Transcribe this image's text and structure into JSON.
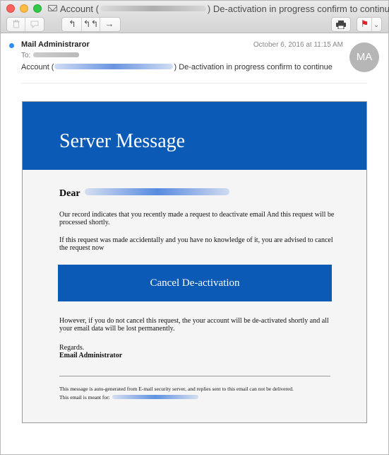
{
  "window": {
    "title_prefix": "Account (",
    "title_suffix": ") De-activation in progress confirm to continue"
  },
  "toolbar": {
    "trash_icon": "trash-icon",
    "junk_icon": "junk-icon",
    "reply_glyph": "↰",
    "reply_all_glyph": "↰↰",
    "forward_glyph": "→",
    "print_glyph": "⎙",
    "flag_glyph": "⚑",
    "flag_menu_glyph": "⌄"
  },
  "header": {
    "from": "Mail Administraror",
    "to_label": "To:",
    "subject_prefix": "Account (",
    "subject_suffix": ") De-activation in progress confirm to continue",
    "date": "October 6, 2016 at 11:15 AM",
    "avatar_initials": "MA"
  },
  "body": {
    "banner_title": "Server Message",
    "greeting": "Dear",
    "para1": "Our record indicates that you recently made a request to deactivate email And this request will be processed shortly.",
    "para2": "If this request was made accidentally and you have no knowledge of it, you are advised to cancel the request now",
    "cta_label": "Cancel De-activation",
    "para3": "However, if you do not cancel this request, the your account will be de-activated shortly and all your email data will be lost permanently.",
    "regards": "Regards.",
    "signature": "Email Administrator",
    "footer1": "This message is auto-generated from E-mail security server, and replies sent to this email can not be delivered.",
    "footer2": "This email is meant for:"
  },
  "colors": {
    "brand_blue": "#0b5ab6",
    "unread_dot": "#2d8ef5",
    "flag_red": "#e0202c"
  }
}
